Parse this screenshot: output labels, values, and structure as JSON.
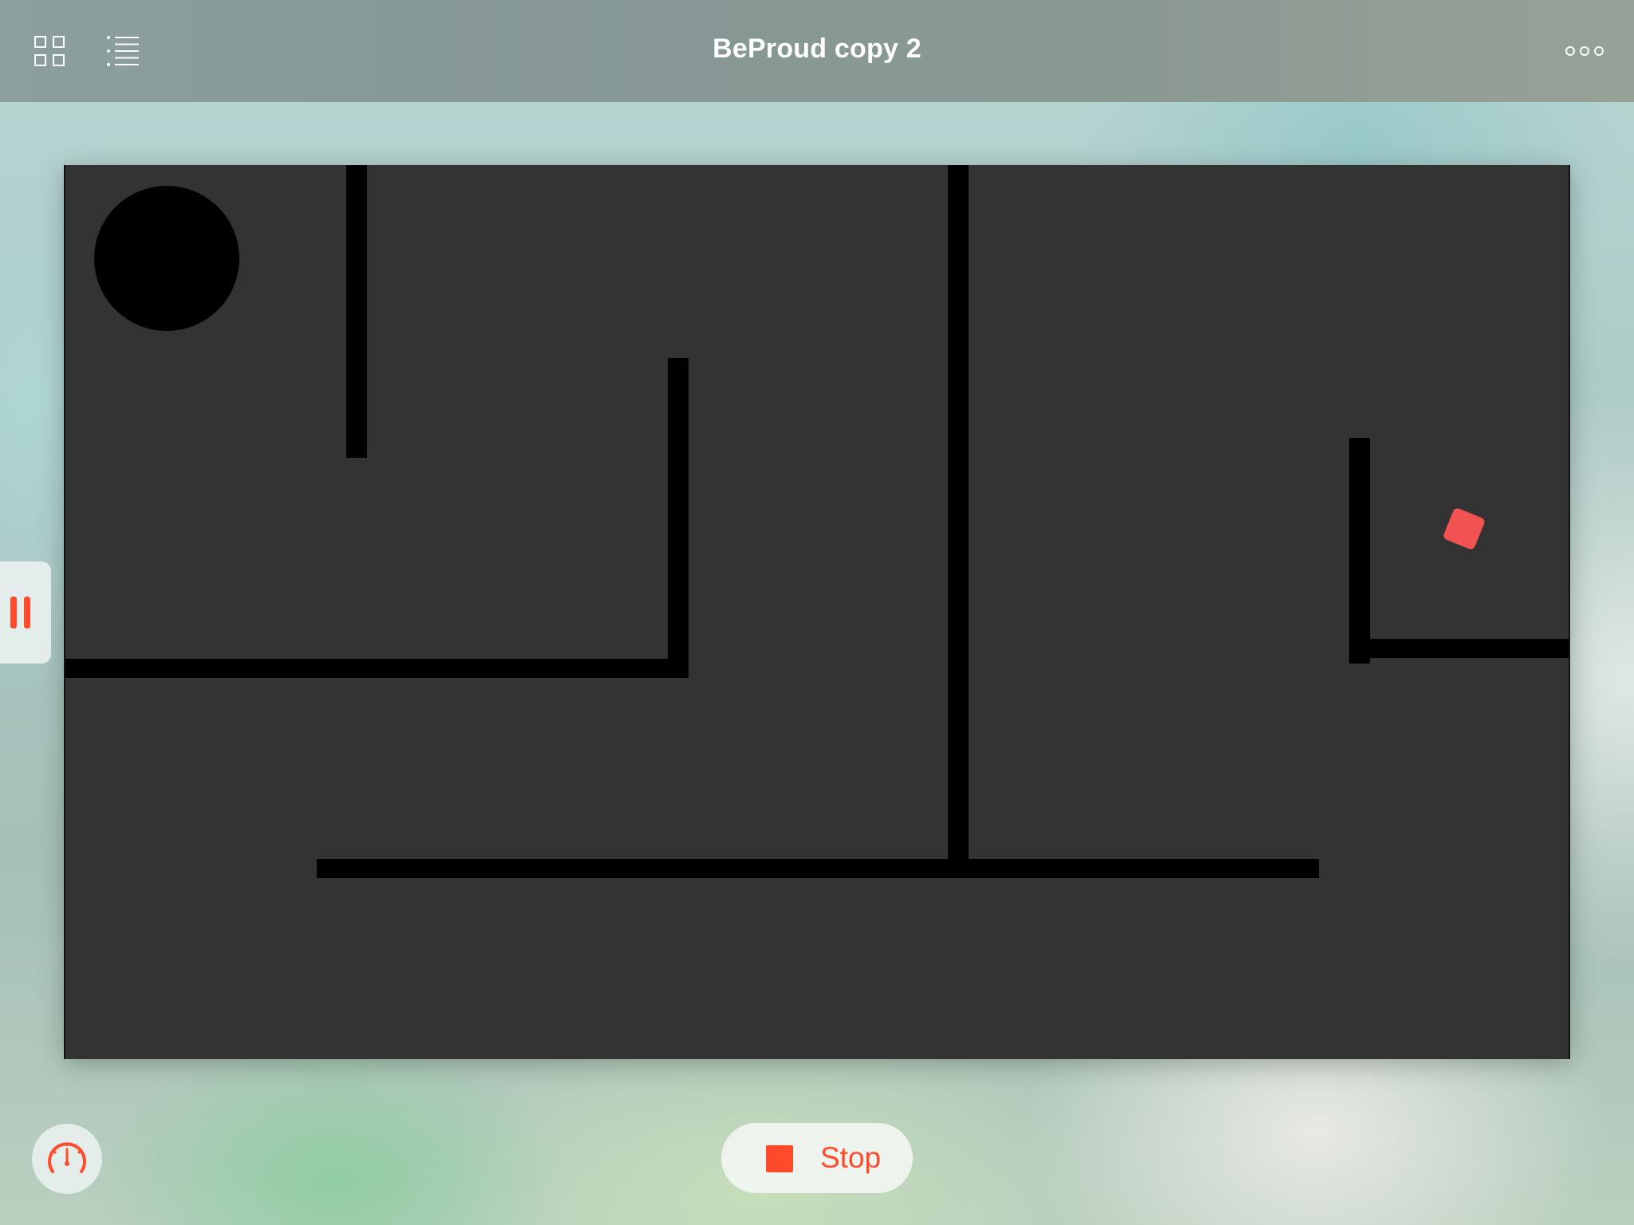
{
  "app": {
    "title": "BeProud copy 2"
  },
  "toolbar": {
    "left_icons": [
      "grid-icon",
      "list-icon"
    ],
    "right_icons": [
      "more-icon"
    ]
  },
  "controls": {
    "pause_icon": "pause-icon",
    "speedometer_icon": "speedometer-icon",
    "stop_icon": "stop-square-icon",
    "stop_label": "Stop"
  },
  "colors": {
    "accent": "#ff4b2b",
    "scene_background": "#333333",
    "walls": "#000000",
    "player": "#f25252",
    "title_text": "#ffffff"
  }
}
